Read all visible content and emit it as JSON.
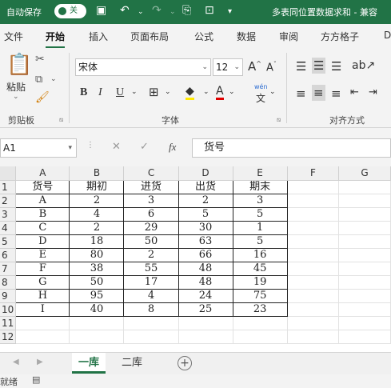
{
  "titlebar": {
    "autosave_label": "自动保存",
    "autosave_state": "关",
    "doc_title": "多表同位置数据求和 - 兼容"
  },
  "ribbon_tabs": [
    "文件",
    "开始",
    "插入",
    "页面布局",
    "公式",
    "数据",
    "审阅",
    "方方格子",
    "D"
  ],
  "ribbon": {
    "paste_label": "粘贴",
    "clipboard_group": "剪贴板",
    "font_name": "宋体",
    "font_size": "12",
    "grow_font": "A",
    "shrink_font": "A",
    "bold": "B",
    "italic": "I",
    "underline": "U",
    "font_group": "字体",
    "wen_label": "wén",
    "wen_char": "文",
    "align_group": "对齐方式"
  },
  "formula_bar": {
    "name_box": "A1",
    "fx": "fx",
    "content": "货号"
  },
  "sheet": {
    "columns": [
      "A",
      "B",
      "C",
      "D",
      "E",
      "F",
      "G"
    ],
    "rows": [
      "1",
      "2",
      "3",
      "4",
      "5",
      "6",
      "7",
      "8",
      "9",
      "10",
      "11",
      "12"
    ],
    "headers": [
      "货号",
      "期初",
      "进货",
      "出货",
      "期末"
    ],
    "data": [
      [
        "A",
        "2",
        "3",
        "2",
        "3"
      ],
      [
        "B",
        "4",
        "6",
        "5",
        "5"
      ],
      [
        "C",
        "2",
        "29",
        "30",
        "1"
      ],
      [
        "D",
        "18",
        "50",
        "63",
        "5"
      ],
      [
        "E",
        "80",
        "2",
        "66",
        "16"
      ],
      [
        "F",
        "38",
        "55",
        "48",
        "45"
      ],
      [
        "G",
        "50",
        "17",
        "48",
        "19"
      ],
      [
        "H",
        "95",
        "4",
        "24",
        "75"
      ],
      [
        "I",
        "40",
        "8",
        "25",
        "23"
      ]
    ]
  },
  "sheet_tabs": [
    "一库",
    "二库"
  ],
  "add_sheet": "+",
  "status": "就绪",
  "colors": {
    "accent": "#217346"
  }
}
